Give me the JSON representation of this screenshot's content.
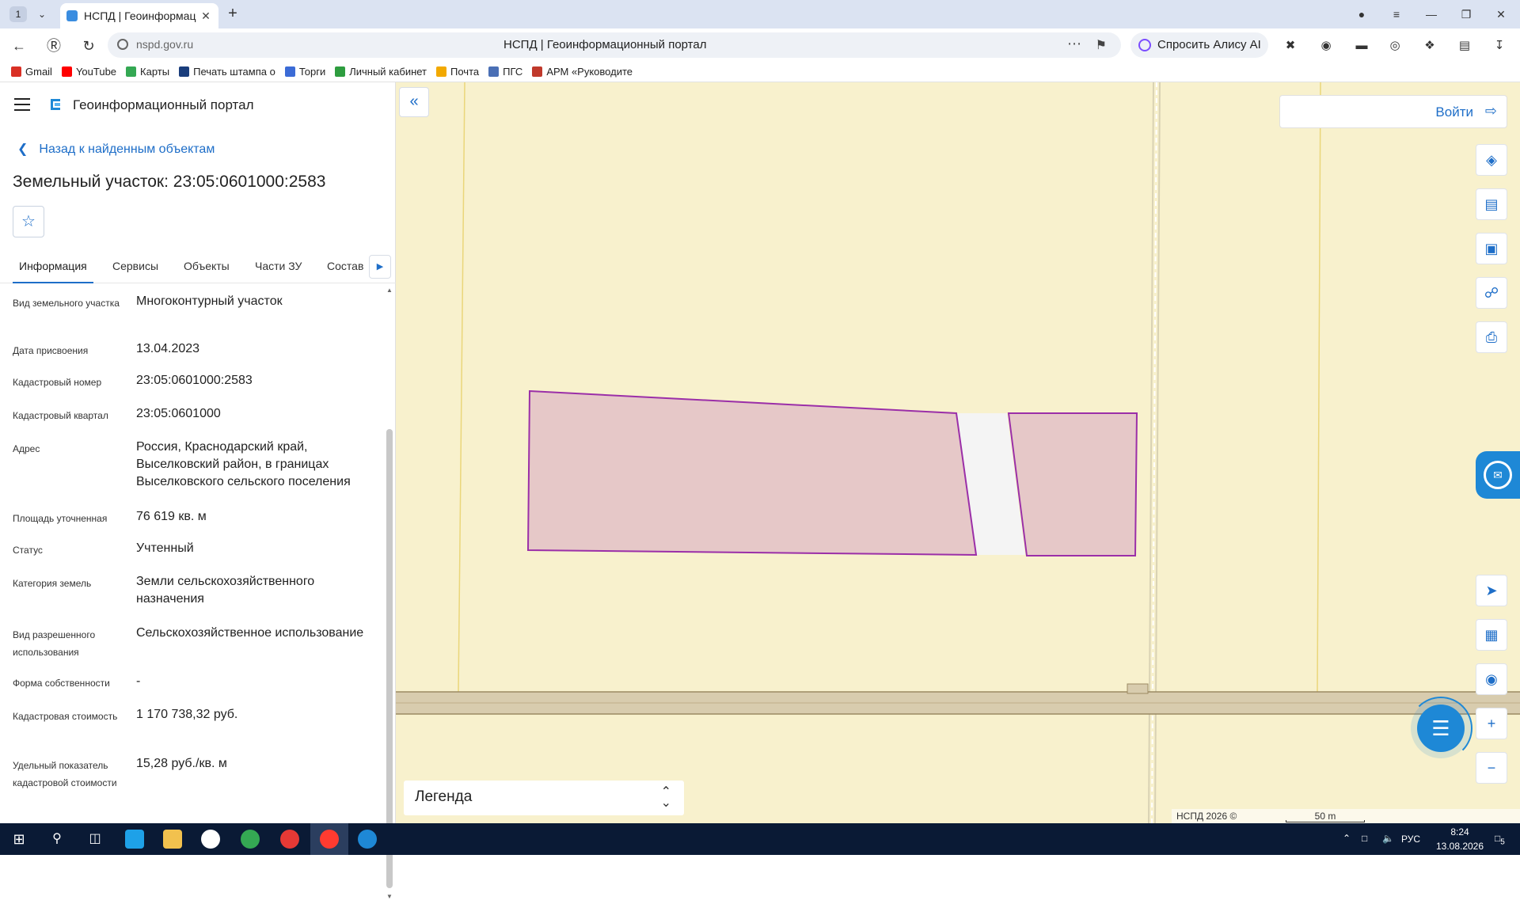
{
  "browser": {
    "tab_count": "1",
    "tab_title": "НСПД | Геоинформац",
    "url": "nspd.gov.ru",
    "page_title": "НСПД | Геоинформационный портал",
    "alice_label": "Спросить Алису AI",
    "bookmarks": [
      {
        "label": "Gmail",
        "color": "#d93025"
      },
      {
        "label": "YouTube",
        "color": "#ff0000"
      },
      {
        "label": "Карты",
        "color": "#34a853"
      },
      {
        "label": "Печать штампа о",
        "color": "#1a3d7c"
      },
      {
        "label": "Торги",
        "color": "#3b6bd6"
      },
      {
        "label": "Личный кабинет",
        "color": "#2e9d3f"
      },
      {
        "label": "Почта",
        "color": "#f2a900"
      },
      {
        "label": "ПГС",
        "color": "#4a6fb5"
      },
      {
        "label": "АРМ «Руководите",
        "color": "#c0392b"
      }
    ]
  },
  "panel": {
    "brand": "Геоинформационный портал",
    "back_link": "Назад к найденным объектам",
    "object_title": "Земельный участок: 23:05:0601000:2583",
    "tabs": [
      "Информация",
      "Сервисы",
      "Объекты",
      "Части ЗУ",
      "Состав"
    ],
    "rows": [
      {
        "label": "Вид земельного участка",
        "value": "Многоконтурный участок"
      },
      {
        "label": "Дата присвоения",
        "value": "13.04.2023"
      },
      {
        "label": "Кадастровый номер",
        "value": "23:05:0601000:2583"
      },
      {
        "label": "Кадастровый квартал",
        "value": "23:05:0601000"
      },
      {
        "label": "Адрес",
        "value": "Россия, Краснодарский край, Выселковский район, в границах Выселковского сельского поселения"
      },
      {
        "label": "Площадь уточненная",
        "value": "76 619 кв. м"
      },
      {
        "label": "Статус",
        "value": "Учтенный"
      },
      {
        "label": "Категория земель",
        "value": "Земли сельскохозяйственного назначения"
      },
      {
        "label": "Вид разрешенного использования",
        "value": "Сельскохозяйственное использование"
      },
      {
        "label": "Форма собственности",
        "value": "-"
      },
      {
        "label": "Кадастровая стоимость",
        "value": "1 170 738,32 руб."
      },
      {
        "label": "Удельный показатель кадастровой стоимости",
        "value": "15,28 руб./кв. м"
      }
    ]
  },
  "map": {
    "login_label": "Войти",
    "legend_label": "Легенда",
    "copyright": "НСПД 2026 ©",
    "scale": "50 m",
    "colors": {
      "background": "#f8f1cd",
      "parcel_fill": "#e6c8c8",
      "parcel_stroke": "#9b2fa8",
      "road": "#d8ccae"
    }
  },
  "taskbar": {
    "lang": "РУС",
    "time": "8:24",
    "date": "13.08.2026",
    "notifications": "5"
  }
}
